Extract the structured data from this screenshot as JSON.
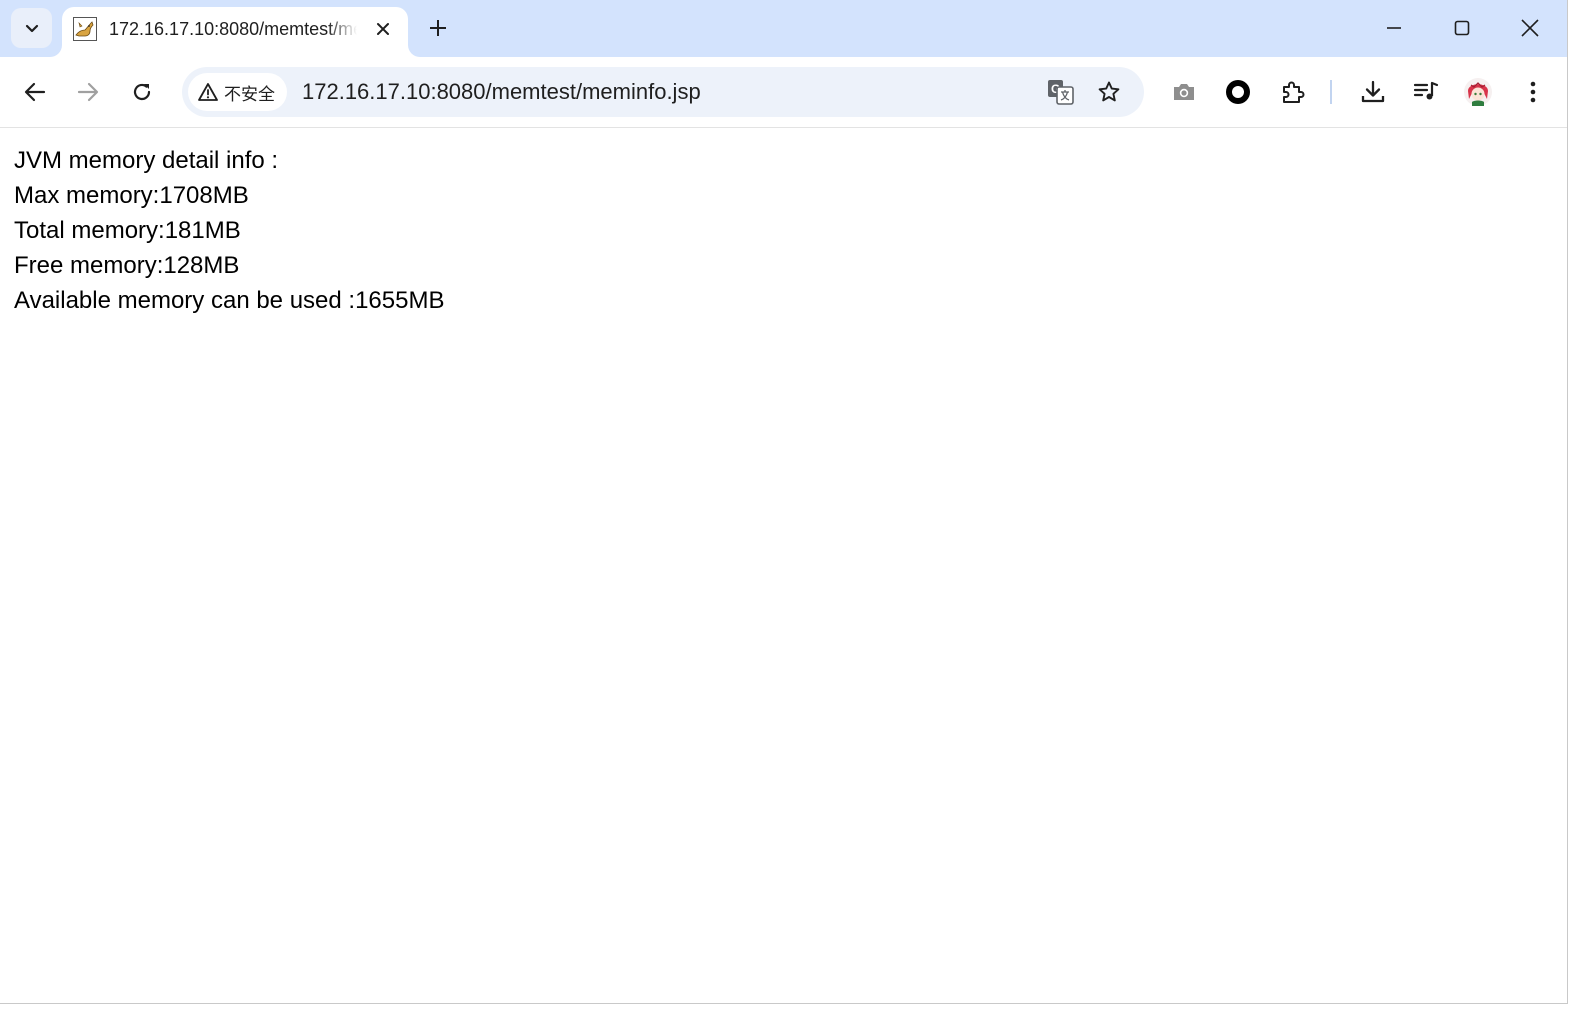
{
  "browser": {
    "tab": {
      "title": "172.16.17.10:8080/memtest/meminfo.jsp",
      "favicon": "tomcat-favicon-icon"
    },
    "new_tab_icon": "plus-icon",
    "tab_search_icon": "chevron-down-icon",
    "window_controls": [
      "minimize-icon",
      "maximize-icon",
      "close-icon"
    ],
    "toolbar": {
      "security_label": "不安全",
      "security_icon": "warning-icon",
      "url": "172.16.17.10:8080/memtest/meminfo.jsp",
      "icons": [
        "back-icon",
        "forward-icon",
        "reload-icon",
        "translate-icon",
        "bookmark-star-icon",
        "camera-icon",
        "record-icon",
        "extensions-icon",
        "download-icon",
        "media-control-icon",
        "profile-avatar-icon",
        "more-menu-icon"
      ]
    },
    "colors": {
      "tabstrip_bg": "#d3e3fd",
      "omnibox_bg": "#edf2fa",
      "active_tab_bg": "#ffffff"
    }
  },
  "page": {
    "lines": [
      "JVM memory detail info :",
      "Max memory:1708MB",
      "Total memory:181MB",
      "Free memory:128MB",
      "Available memory can be used :1655MB"
    ]
  }
}
